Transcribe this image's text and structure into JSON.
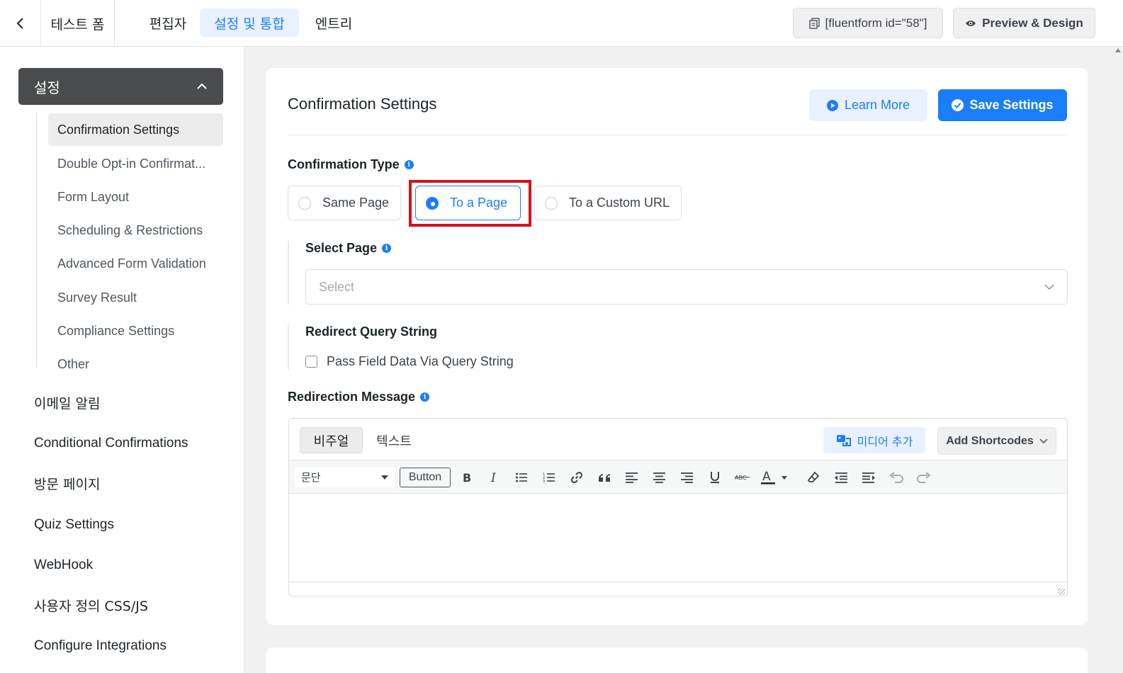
{
  "topbar": {
    "form_name": "테스트 폼",
    "tabs": [
      {
        "label": "편집자",
        "active": false
      },
      {
        "label": "설정 및 통합",
        "active": true
      },
      {
        "label": "엔트리",
        "active": false
      }
    ],
    "shortcode": "[fluentform id=\"58\"]",
    "preview_label": "Preview & Design"
  },
  "sidebar": {
    "section_title": "설정",
    "sub_items": [
      {
        "label": "Confirmation Settings",
        "active": true
      },
      {
        "label": "Double Opt-in Confirmat...",
        "active": false
      },
      {
        "label": "Form Layout",
        "active": false
      },
      {
        "label": "Scheduling & Restrictions",
        "active": false
      },
      {
        "label": "Advanced Form Validation",
        "active": false
      },
      {
        "label": "Survey Result",
        "active": false
      },
      {
        "label": "Compliance Settings",
        "active": false
      },
      {
        "label": "Other",
        "active": false
      }
    ],
    "items": [
      {
        "label": "이메일 알림"
      },
      {
        "label": "Conditional Confirmations"
      },
      {
        "label": "방문 페이지"
      },
      {
        "label": "Quiz Settings"
      },
      {
        "label": "WebHook"
      },
      {
        "label": "사용자 정의 CSS/JS"
      },
      {
        "label": "Configure Integrations"
      }
    ]
  },
  "main": {
    "title": "Confirmation Settings",
    "learn_more_label": "Learn More",
    "save_label": "Save Settings",
    "confirmation_type": {
      "label": "Confirmation Type",
      "options": [
        {
          "label": "Same Page",
          "checked": false
        },
        {
          "label": "To a Page",
          "checked": true
        },
        {
          "label": "To a Custom URL",
          "checked": false
        }
      ]
    },
    "select_page": {
      "label": "Select Page",
      "placeholder": "Select"
    },
    "redirect_query": {
      "label": "Redirect Query String",
      "checkbox_label": "Pass Field Data Via Query String",
      "checked": false
    },
    "redirection_message": {
      "label": "Redirection Message",
      "tabs": [
        {
          "label": "비주얼",
          "active": true
        },
        {
          "label": "텍스트",
          "active": false
        }
      ],
      "add_media_label": "미디어 추가",
      "add_shortcodes_label": "Add Shortcodes",
      "format_select": "문단",
      "button_tool_label": "Button",
      "toolbar_icons": [
        "bold-icon",
        "italic-icon",
        "bullet-list-icon",
        "numbered-list-icon",
        "link-icon",
        "blockquote-icon",
        "align-left-icon",
        "align-center-icon",
        "align-right-icon",
        "underline-icon",
        "strikethrough-icon",
        "text-color-icon",
        "clear-formatting-icon",
        "outdent-icon",
        "indent-icon",
        "undo-icon",
        "redo-icon"
      ],
      "strike_text": "ABC",
      "text_color_glyph": "A"
    }
  },
  "colors": {
    "accent": "#1a7efb",
    "highlight": "#d6101d",
    "sidebar_head": "#4b4c4d"
  }
}
